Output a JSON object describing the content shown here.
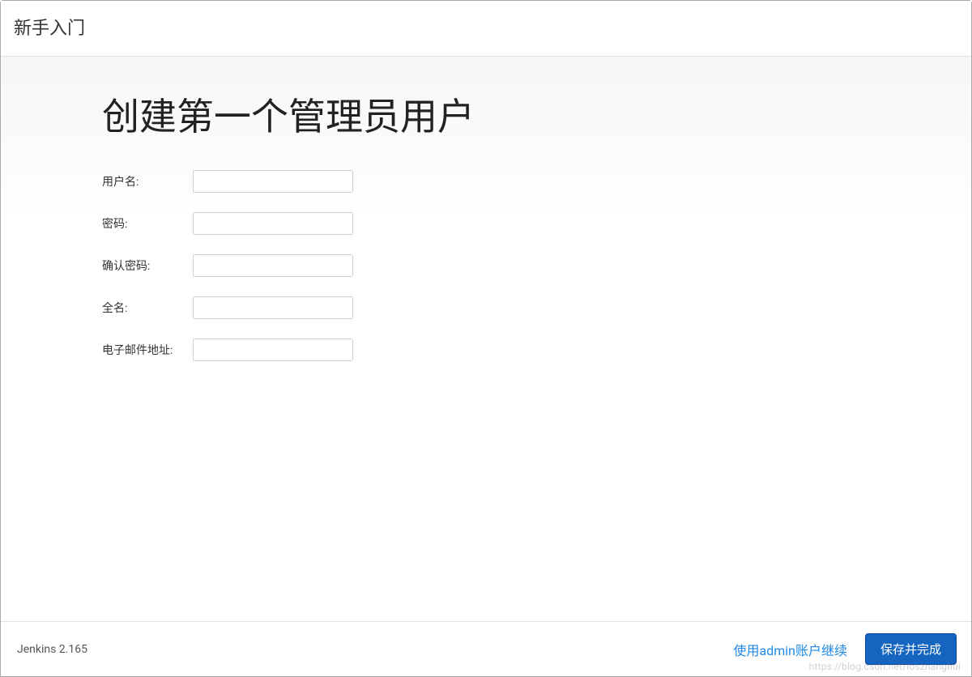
{
  "header": {
    "title": "新手入门"
  },
  "main": {
    "title": "创建第一个管理员用户",
    "form": {
      "username_label": "用户名:",
      "username_value": "",
      "password_label": "密码:",
      "password_value": "",
      "confirm_password_label": "确认密码:",
      "confirm_password_value": "",
      "fullname_label": "全名:",
      "fullname_value": "",
      "email_label": "电子邮件地址:",
      "email_value": ""
    }
  },
  "footer": {
    "version_text": "Jenkins 2.165",
    "continue_as_admin_label": "使用admin账户继续",
    "save_button_label": "保存并完成"
  },
  "watermark": "https://blog.csdn.net/ioszhanghui"
}
